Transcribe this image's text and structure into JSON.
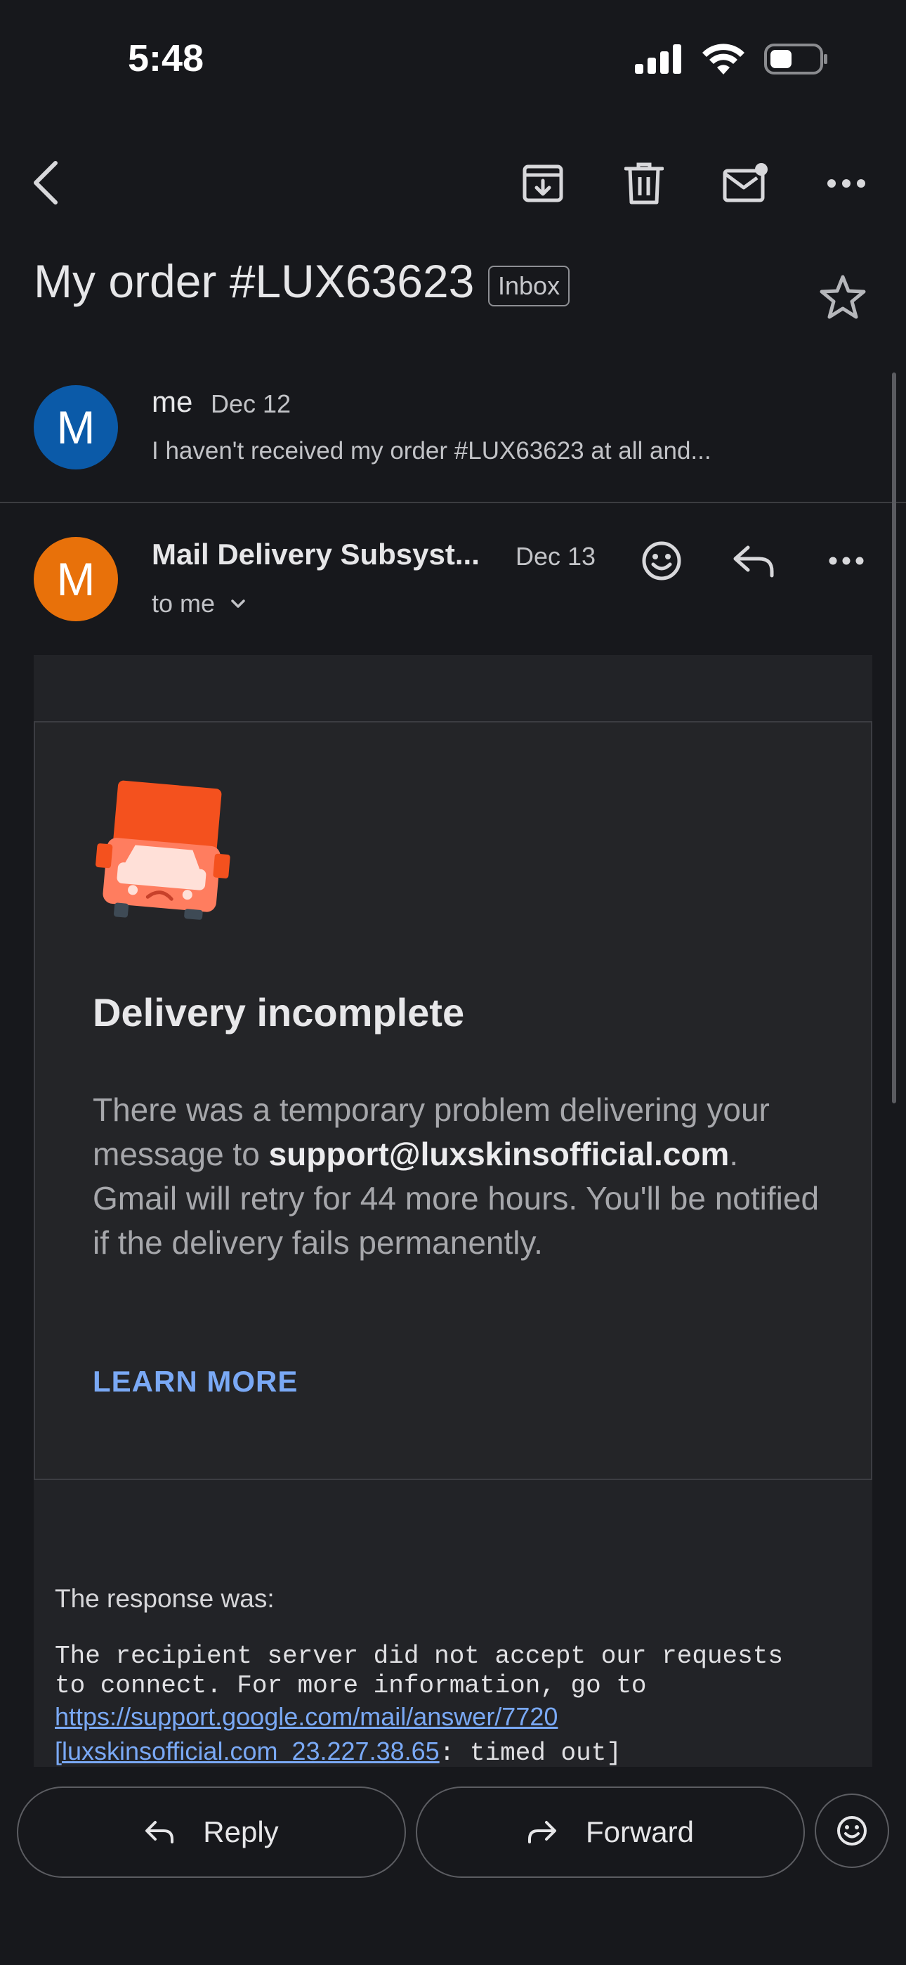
{
  "status_bar": {
    "time": "5:48"
  },
  "subject": {
    "title": "My order #LUX63623",
    "label": "Inbox"
  },
  "messages": [
    {
      "avatar_letter": "M",
      "avatar_color": "#0b5aa8",
      "sender": "me",
      "date": "Dec 12",
      "snippet": "I haven't received my order #LUX63623 at all and..."
    },
    {
      "avatar_letter": "M",
      "avatar_color": "#e8710a",
      "sender": "Mail Delivery Subsyst...",
      "date": "Dec 13",
      "recipient": "to me"
    }
  ],
  "email": {
    "title": "Delivery incomplete",
    "text_before": "There was a temporary problem delivering your message to ",
    "email_address": "support@luxskinsofficial.com",
    "text_after": ". Gmail will retry for 44 more hours. You'll be notified if the delivery fails permanently.",
    "learn_more": "LEARN MORE",
    "response_label": "The response was:",
    "response_line1": "The recipient server did not accept our requests",
    "response_line2": "to connect. For more information, go to",
    "response_link": "https://support.google.com/mail/answer/7720",
    "response_line4_bracket": "[",
    "response_line4_domain": "luxskinsofficial.com  23.227.38.65",
    "response_line4_tail": ": timed out]"
  },
  "actions": {
    "reply": "Reply",
    "forward": "Forward"
  },
  "colors": {
    "accent_link": "#7aa9f5",
    "background": "#17181c",
    "card": "#242528"
  }
}
